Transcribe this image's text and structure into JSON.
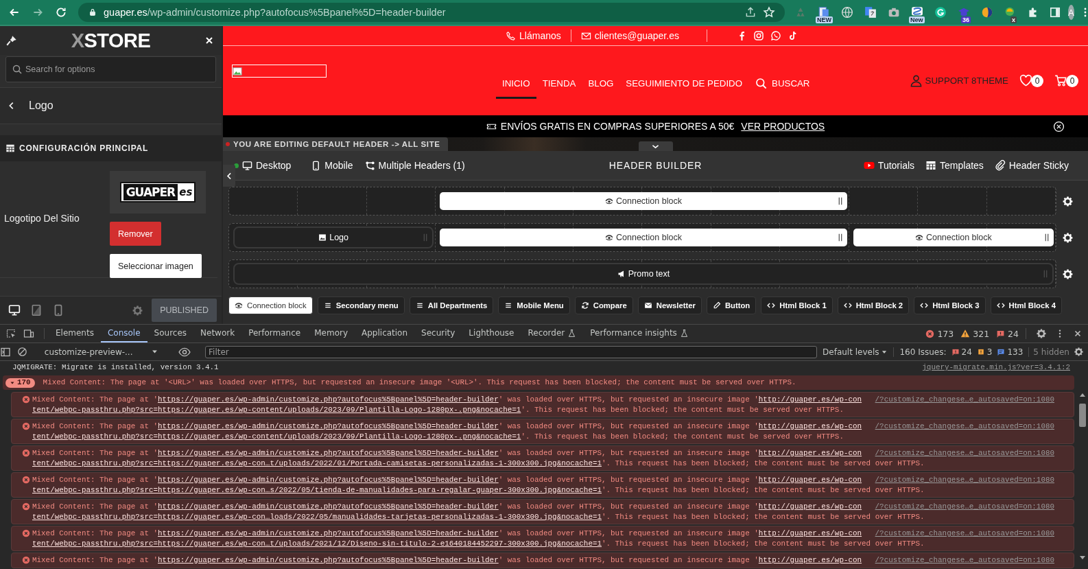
{
  "browser": {
    "url_host": "guaper.es",
    "url_path": "/wp-admin/customize.php?autofocus%5Bpanel%5D=header-builder",
    "extensions": [
      {
        "kind": "recycle"
      },
      {
        "kind": "document",
        "badge": "NEW"
      },
      {
        "kind": "globe"
      },
      {
        "kind": "translate"
      },
      {
        "kind": "camera"
      },
      {
        "kind": "scribble",
        "badge": "New"
      },
      {
        "kind": "grammar"
      },
      {
        "kind": "cap",
        "badge": "36"
      },
      {
        "kind": "orb"
      },
      {
        "kind": "satellite",
        "badge": "x"
      }
    ],
    "avatar": "A"
  },
  "customizer": {
    "brand": "XSTORE",
    "search": {
      "placeholder": "Search for options"
    },
    "section": "Logo",
    "heading": "CONFIGURACIÓN PRINCIPAL",
    "setting": {
      "label": "Logotipo Del Sitio",
      "logo_text": "GUAPER",
      "logo_suffix": "es",
      "buttons": [
        {
          "label": "Remover",
          "kind": "danger"
        },
        {
          "label": "Seleccionar imagen",
          "kind": "plain"
        }
      ]
    },
    "devices": [
      {
        "kind": "desktop",
        "selected": true
      },
      {
        "kind": "tablet",
        "selected": false
      },
      {
        "kind": "mobile",
        "selected": false
      }
    ],
    "publish": {
      "label": "PUBLISHED",
      "disabled": true
    }
  },
  "preview": {
    "topbar": {
      "phone": "Llámanos",
      "email": "clientes@guaper.es",
      "social": [
        {
          "kind": "facebook"
        },
        {
          "kind": "instagram"
        },
        {
          "kind": "whatsapp"
        },
        {
          "kind": "tiktok"
        }
      ]
    },
    "nav": [
      {
        "label": "INICIO",
        "kind": "link",
        "selected": true
      },
      {
        "label": "TIENDA",
        "kind": "link",
        "selected": false
      },
      {
        "label": "BLOG",
        "kind": "link",
        "selected": false
      },
      {
        "label": "SEGUIMIENTO DE PEDIDO",
        "kind": "link",
        "selected": false
      },
      {
        "label": "BUSCAR",
        "kind": "search",
        "selected": false
      }
    ],
    "account": "SUPPORT 8THEME",
    "wishlist_count": "0",
    "cart_count": "0",
    "promo": {
      "text": "ENVÍOS GRATIS EN COMPRAS SUPERIORES A 50€",
      "link": "VER PRODUCTOS"
    }
  },
  "builder": {
    "notice": "YOU ARE EDITING DEFAULT HEADER -> ALL SITE",
    "modes": [
      {
        "label": "Desktop",
        "kind": "desktop",
        "selected": true
      },
      {
        "label": "Mobile",
        "kind": "mobile",
        "selected": false
      }
    ],
    "multiple_headers": "Multiple Headers (1)",
    "title": "HEADER BUILDER",
    "links": [
      {
        "label": "Tutorials",
        "kind": "video"
      },
      {
        "label": "Templates",
        "kind": "templates"
      },
      {
        "label": "Header Sticky",
        "kind": "sticky"
      }
    ],
    "rows": [
      {
        "blocks": [
          {
            "label": "Connection block",
            "kind": "connection"
          }
        ]
      },
      {
        "blocks": [
          {
            "label": "Logo",
            "kind": "logo"
          },
          {
            "label": "Connection block",
            "kind": "connection"
          },
          {
            "label": "Connection block",
            "kind": "connection"
          }
        ]
      },
      {
        "blocks": [
          {
            "label": "Promo text",
            "kind": "promo"
          }
        ]
      }
    ],
    "elements": [
      {
        "label": "Connection block",
        "kind": "connection"
      },
      {
        "label": "Secondary menu",
        "kind": "menu"
      },
      {
        "label": "All Departments",
        "kind": "menu"
      },
      {
        "label": "Mobile Menu",
        "kind": "menu"
      },
      {
        "label": "Compare",
        "kind": "compare"
      },
      {
        "label": "Newsletter",
        "kind": "newsletter"
      },
      {
        "label": "Button",
        "kind": "button"
      },
      {
        "label": "Html Block 1",
        "kind": "html"
      },
      {
        "label": "Html Block 2",
        "kind": "html"
      },
      {
        "label": "Html Block 3",
        "kind": "html"
      },
      {
        "label": "Html Block 4",
        "kind": "html"
      }
    ]
  },
  "devtools": {
    "tabs": [
      {
        "label": "Elements",
        "selected": false,
        "experimental": false
      },
      {
        "label": "Console",
        "selected": true,
        "experimental": false
      },
      {
        "label": "Sources",
        "selected": false,
        "experimental": false
      },
      {
        "label": "Network",
        "selected": false,
        "experimental": false
      },
      {
        "label": "Performance",
        "selected": false,
        "experimental": false
      },
      {
        "label": "Memory",
        "selected": false,
        "experimental": false
      },
      {
        "label": "Application",
        "selected": false,
        "experimental": false
      },
      {
        "label": "Security",
        "selected": false,
        "experimental": false
      },
      {
        "label": "Lighthouse",
        "selected": false,
        "experimental": false
      },
      {
        "label": "Recorder",
        "selected": false,
        "experimental": true
      },
      {
        "label": "Performance insights",
        "selected": false,
        "experimental": true
      }
    ],
    "counts": {
      "errors": "173",
      "warnings": "321",
      "issues": "24"
    },
    "context": "customize-preview-...",
    "filter": {
      "placeholder": "Filter"
    },
    "levels": "Default levels",
    "issues": {
      "label": "160 Issues:",
      "errors": "24",
      "warnings": "3",
      "info": "133"
    },
    "hidden": "5 hidden",
    "console": {
      "log": {
        "text": "JQMIGRATE: Migrate is installed, version 3.4.1",
        "source": "jquery-migrate.min.js?ver=3.4.1:2"
      },
      "group": {
        "count": "170",
        "expanded": true,
        "text": "Mixed Content: The page at '<URL>' was loaded over HTTPS, but requested an insecure image '<URL>'. This request has been blocked; the content must be served over HTTPS."
      },
      "messages": [
        {
          "text_start": "Mixed Content: The page at '",
          "page_url": "https://guaper.es/wp-admin/customize.php?autofocus%5Bpanel%5D=header-builder",
          "text_middle": "' was loaded over HTTPS, but requested an insecure image '",
          "image_url": "http://guaper.es/wp-con",
          "image_url_continued": "tent/webpc-passthru.php?src=https://guaper.es/wp-content/uploads/2023/09/Plantilla-Logo-1280px-.png&nocache=1",
          "text_end": "'. This request has been blocked; the content must be served over HTTPS.",
          "source": "/?customize_changese…e_autosaved=on:1080"
        },
        {
          "text_start": "Mixed Content: The page at '",
          "page_url": "https://guaper.es/wp-admin/customize.php?autofocus%5Bpanel%5D=header-builder",
          "text_middle": "' was loaded over HTTPS, but requested an insecure image '",
          "image_url": "http://guaper.es/wp-con",
          "image_url_continued": "tent/webpc-passthru.php?src=https://guaper.es/wp-content/uploads/2023/09/Plantilla-Logo-1280px-.png&nocache=1",
          "text_end": "'. This request has been blocked; the content must be served over HTTPS.",
          "source": "/?customize_changese…e_autosaved=on:1080"
        },
        {
          "text_start": "Mixed Content: The page at '",
          "page_url": "https://guaper.es/wp-admin/customize.php?autofocus%5Bpanel%5D=header-builder",
          "text_middle": "' was loaded over HTTPS, but requested an insecure image '",
          "image_url": "http://guaper.es/wp-con",
          "image_url_continued": "tent/webpc-passthru.php?src=https://guaper.es/wp-con…t/uploads/2022/01/Portada-camisetas-personalizadas-1-300x300.jpg&nocache=1",
          "text_end": "'. This request has been blocked; the content must be served over HTTPS.",
          "source": "/?customize_changese…e_autosaved=on:1080"
        },
        {
          "text_start": "Mixed Content: The page at '",
          "page_url": "https://guaper.es/wp-admin/customize.php?autofocus%5Bpanel%5D=header-builder",
          "text_middle": "' was loaded over HTTPS, but requested an insecure image '",
          "image_url": "http://guaper.es/wp-con",
          "image_url_continued": "tent/webpc-passthru.php?src=https://guaper.es/wp-con…s/2022/05/tienda-de-manualidades-para-regalar-guaper-300x300.jpg&nocache=1",
          "text_end": "'. This request has been blocked; the content must be served over HTTPS.",
          "source": "/?customize_changese…e_autosaved=on:1080"
        },
        {
          "text_start": "Mixed Content: The page at '",
          "page_url": "https://guaper.es/wp-admin/customize.php?autofocus%5Bpanel%5D=header-builder",
          "text_middle": "' was loaded over HTTPS, but requested an insecure image '",
          "image_url": "http://guaper.es/wp-con",
          "image_url_continued": "tent/webpc-passthru.php?src=https://guaper.es/wp-con…loads/2022/05/manualidades-tarjetas-personalizadas-1-300x300.jpg&nocache=1",
          "text_end": "'. This request has been blocked; the content must be served over HTTPS.",
          "source": "/?customize_changese…e_autosaved=on:1080"
        },
        {
          "text_start": "Mixed Content: The page at '",
          "page_url": "https://guaper.es/wp-admin/customize.php?autofocus%5Bpanel%5D=header-builder",
          "text_middle": "' was loaded over HTTPS, but requested an insecure image '",
          "image_url": "http://guaper.es/wp-con",
          "image_url_continued": "tent/webpc-passthru.php?src=https://guaper.es/wp-con…t/uploads/2021/12/Diseno-sin-titulo-2-e1640184452297-300x300.jpg&nocache=1",
          "text_end": "'. This request has been blocked; the content must be served over HTTPS.",
          "source": "/?customize_changese…e_autosaved=on:1080"
        },
        {
          "text_start": "Mixed Content: The page at '",
          "page_url": "https://guaper.es/wp-admin/customize.php?autofocus%5Bpanel%5D=header-builder",
          "text_middle": "' was loaded over HTTPS, but requested an insecure image '",
          "image_url": "http://guaper.es/wp-con",
          "source": "/?customize_changese…e_autosaved=on:1080"
        }
      ]
    }
  }
}
